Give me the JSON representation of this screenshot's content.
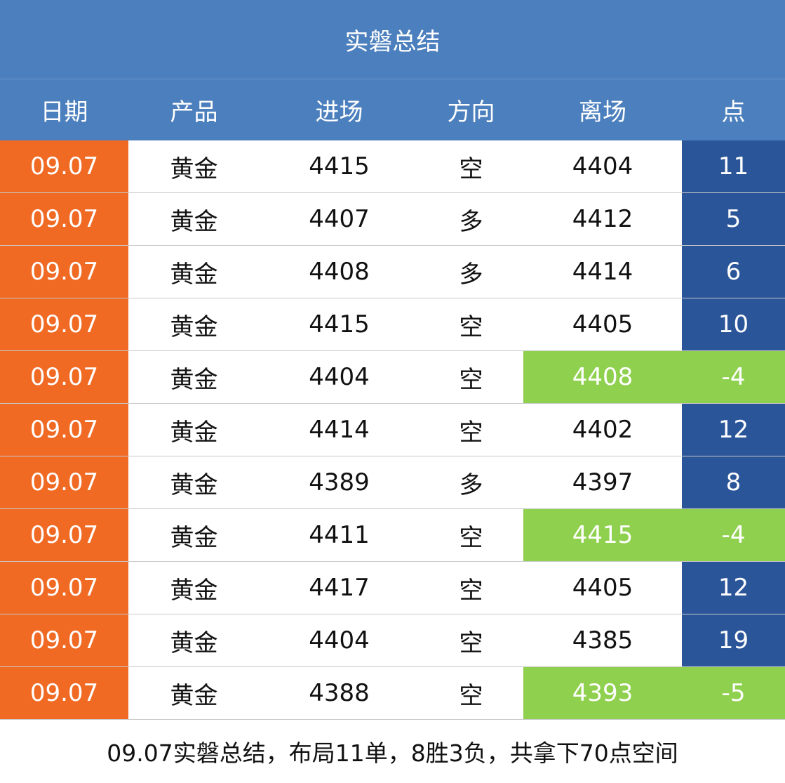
{
  "title": "实磐总结",
  "headers": [
    "日期",
    "产品",
    "进场",
    "方向",
    "离场",
    "点"
  ],
  "rows": [
    {
      "date": "09.07",
      "product": "黄金",
      "entry": "4415",
      "direction": "空",
      "exit": "4404",
      "points": "11",
      "loss": false
    },
    {
      "date": "09.07",
      "product": "黄金",
      "entry": "4407",
      "direction": "多",
      "exit": "4412",
      "points": "5",
      "loss": false
    },
    {
      "date": "09.07",
      "product": "黄金",
      "entry": "4408",
      "direction": "多",
      "exit": "4414",
      "points": "6",
      "loss": false
    },
    {
      "date": "09.07",
      "product": "黄金",
      "entry": "4415",
      "direction": "空",
      "exit": "4405",
      "points": "10",
      "loss": false
    },
    {
      "date": "09.07",
      "product": "黄金",
      "entry": "4404",
      "direction": "空",
      "exit": "4408",
      "points": "-4",
      "loss": true
    },
    {
      "date": "09.07",
      "product": "黄金",
      "entry": "4414",
      "direction": "空",
      "exit": "4402",
      "points": "12",
      "loss": false
    },
    {
      "date": "09.07",
      "product": "黄金",
      "entry": "4389",
      "direction": "多",
      "exit": "4397",
      "points": "8",
      "loss": false
    },
    {
      "date": "09.07",
      "product": "黄金",
      "entry": "4411",
      "direction": "空",
      "exit": "4415",
      "points": "-4",
      "loss": true
    },
    {
      "date": "09.07",
      "product": "黄金",
      "entry": "4417",
      "direction": "空",
      "exit": "4405",
      "points": "12",
      "loss": false
    },
    {
      "date": "09.07",
      "product": "黄金",
      "entry": "4404",
      "direction": "空",
      "exit": "4385",
      "points": "19",
      "loss": false
    },
    {
      "date": "09.07",
      "product": "黄金",
      "entry": "4388",
      "direction": "空",
      "exit": "4393",
      "points": "-5",
      "loss": true
    }
  ],
  "summary": "09.07实磐总结，布局11单，8胜3负，共拿下70点空间",
  "colors": {
    "header_bg": "#4c7fbd",
    "date_bg": "#f06a24",
    "win_points_bg": "#2b5599",
    "loss_bg": "#8fd04f"
  }
}
